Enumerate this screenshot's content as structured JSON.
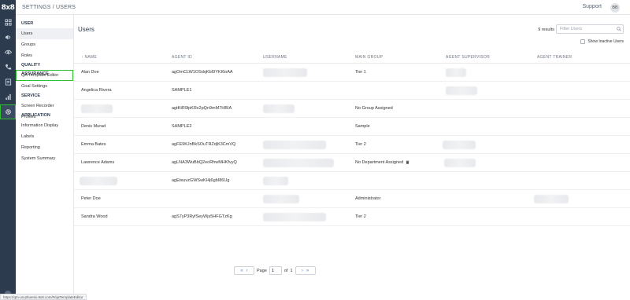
{
  "brand": {
    "logo": "8x8"
  },
  "topbar": {
    "breadcrumb": "SETTINGS / USERS",
    "support": "Support",
    "avatar_initials": "BB"
  },
  "rail_icons": [
    "dashboard-icon",
    "megaphone-icon",
    "eye-icon",
    "phone-icon",
    "report-icon",
    "bar-chart-icon",
    "gear-icon"
  ],
  "sidebar": {
    "sections": [
      {
        "title": "USER",
        "items": [
          "Users",
          "Groups",
          "Roles"
        ]
      },
      {
        "title": "QUALITY ASSURANCE",
        "items": [
          "QA Template Editor",
          "Goal Settings"
        ]
      },
      {
        "title": "SERVICE",
        "items": [
          "Screen Recorder Profiles"
        ]
      },
      {
        "title": "APPLICATION",
        "items": [
          "Information Display",
          "Labels",
          "Reporting",
          "System Summary"
        ]
      }
    ],
    "selected": "Users",
    "highlighted": "QA Template Editor"
  },
  "main": {
    "title": "Users",
    "results": "9 results",
    "filter_placeholder": "Filter Users",
    "show_inactive_label": "Show Inactive Users",
    "columns": [
      "↑ NAME",
      "AGENT ID",
      "USERNAME",
      "MAIN GROUP",
      "AGENT SUPERVISOR",
      "AGENT TRAINER"
    ],
    "rows": [
      {
        "name": "Alan Doe",
        "agent_id": "agOmCLW1OSdqKbI9YKI6oAA",
        "main_group": "Tier 1"
      },
      {
        "name": "Angelica Rivera",
        "agent_id": "SAMPLE1",
        "main_group": ""
      },
      {
        "name": "",
        "agent_id": "agtKtR9lpKRx2pQn9mM7HBIA",
        "main_group": "No Group Assigned"
      },
      {
        "name": "Denis Murad",
        "agent_id": "SAMPLE2",
        "main_group": "Sample"
      },
      {
        "name": "Emma Bates",
        "agent_id": "agFE9KJnBkSOuTRZdjK3CmVQ",
        "main_group": "Tier 2"
      },
      {
        "name": "Lawrence Adams",
        "agent_id": "agLNA3WuBbQ2eoRhwMHKfvyQ",
        "main_group": "No Department Assigned"
      },
      {
        "name": "",
        "agent_id": "agEteuvzGWSwKI4j6gbI86Ug",
        "main_group": ""
      },
      {
        "name": "Peter Doe",
        "agent_id": "",
        "main_group": "Administrator"
      },
      {
        "name": "Sandra Wood",
        "agent_id": "agS7yP3RyfSeyWjs5HFGTzKg",
        "main_group": "Tier 2"
      }
    ]
  },
  "pagination": {
    "page_label": "Page",
    "current": "1",
    "of_label": "of",
    "total": "1"
  },
  "statusbar": {
    "url": "https://qm-us-phoenix.8x8.com/#/qaTemplateEditor"
  },
  "colors": {
    "rail": "#2d3b4e",
    "highlight": "#2ec12e",
    "pager_arrow": "#4a8ad8"
  }
}
